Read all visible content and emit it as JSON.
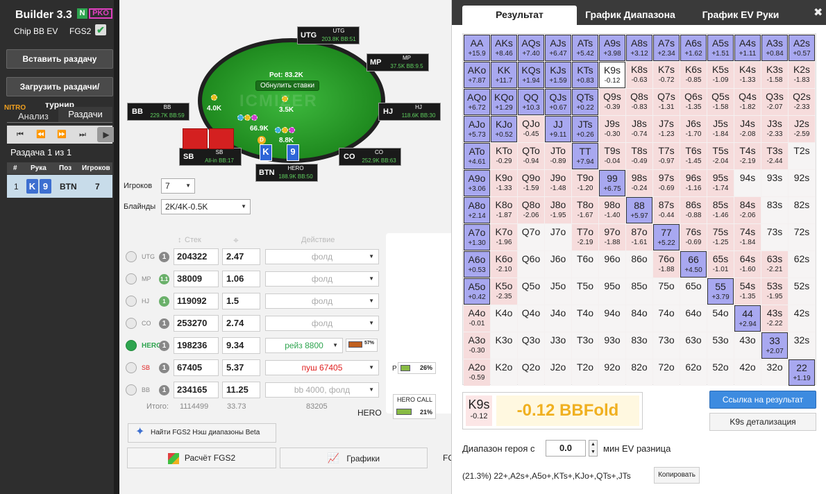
{
  "sidebar": {
    "title": "Builder 3.3",
    "badge_n": "N",
    "badge_pko": "PKO",
    "chip_label": "Chip BB EV",
    "fgs2_label": "FGS2",
    "check_glyph": "✔",
    "paste_btn": "Вставить раздачу",
    "load_btn": "Загрузить раздачи/турнир",
    "nitro": "NITRO",
    "tab_analysis": "Анализ",
    "tab_hands": "Раздачи",
    "hand_info": "Раздача 1 из 1",
    "headers": [
      "#",
      "Рука",
      "Поз",
      "Игроков"
    ],
    "row": {
      "num": "1",
      "card1": "K",
      "card2": "9",
      "pos": "BTN",
      "players": "7"
    }
  },
  "table": {
    "pot": "Pot: 83.2K",
    "reset": "Обнулить ставки",
    "logo": "ICMIZER",
    "seats": {
      "utg": {
        "name": "UTG",
        "label": "UTG",
        "stack": "203.8K BB:51"
      },
      "mp": {
        "name": "MP",
        "label": "MP",
        "stack": "37.5K BB:9.5"
      },
      "hj": {
        "name": "HJ",
        "label": "HJ",
        "stack": "118.6K BB:30"
      },
      "co": {
        "name": "CO",
        "label": "CO",
        "stack": "252.9K BB:63"
      },
      "hero": {
        "name": "BTN",
        "label": "HERO",
        "stack": "188.9K BB:50"
      },
      "sb": {
        "name": "SB",
        "label": "SB",
        "stack": "All-in BB:17"
      },
      "bb": {
        "name": "BB",
        "label": "BB",
        "stack": "229.7K BB:59"
      }
    },
    "bets": {
      "bb": "4.0K",
      "hj": "3.5K",
      "sb": "66.9K",
      "hero": "8.8K"
    },
    "hero_cards": [
      "K",
      "9"
    ],
    "dealer": "D"
  },
  "controls": {
    "players_label": "Игроков",
    "players_value": "7",
    "blinds_label": "Блайнды",
    "blinds_value": "2K/4K-0.5K",
    "col_stack": "Стек",
    "col_action": "Действие",
    "rows": [
      {
        "pos": "UTG",
        "circ": "1",
        "stack": "204322",
        "bb": "2.47",
        "action": "фолд"
      },
      {
        "pos": "MP",
        "circ": "1.1",
        "stack": "38009",
        "bb": "1.06",
        "action": "фолд"
      },
      {
        "pos": "HJ",
        "circ": "1",
        "stack": "119092",
        "bb": "1.5",
        "action": "фолд"
      },
      {
        "pos": "CO",
        "circ": "1",
        "stack": "253270",
        "bb": "2.74",
        "action": "фолд"
      },
      {
        "pos": "HERO",
        "circ": "1",
        "stack": "198236",
        "bb": "9.34",
        "action": "рейз 8800",
        "pct": "57%"
      },
      {
        "pos": "SB",
        "circ": "1",
        "stack": "67405",
        "bb": "5.37",
        "action": "пуш 67405"
      },
      {
        "pos": "BB",
        "circ": "1",
        "stack": "234165",
        "bb": "11.25",
        "action": "bb 4000, фолд"
      }
    ],
    "total_label": "Итого:",
    "total_stack": "1114499",
    "total_bb": "33.73",
    "total_chips": "83205",
    "fgs_btn": "Найти FGS2 Нэш диапазоны Beta",
    "calc_btn": "Расчёт FGS2",
    "charts_btn": "Графики",
    "p_label": "P",
    "p_pct": "26%",
    "hero_call": "HERO CALL",
    "hero_call_pct": "21%",
    "hero_label": "HERO",
    "fc_label": "FC"
  },
  "result": {
    "tabs": [
      "Результат",
      "График Диапазона",
      "График EV Руки"
    ],
    "close": "✖",
    "selected_hand": "K9s",
    "selected_ev": "-0.12",
    "big": "-0.12 BBFold",
    "link_btn": "Ссылка на результат",
    "detail_btn": "K9s детализация",
    "range_label": "Диапазон героя с",
    "min_ev": "0.0",
    "range_suffix": "мин EV разница",
    "range_str": "(21.3%) 22+,A2s+,A5o+,KTs+,KJo+,QTs+,JTs",
    "copy_btn": "Копировать",
    "grid": [
      [
        [
          "AA",
          "+15.9",
          "in"
        ],
        [
          "AKs",
          "+8.46",
          "in"
        ],
        [
          "AQs",
          "+7.40",
          "in"
        ],
        [
          "AJs",
          "+6.47",
          "in"
        ],
        [
          "ATs",
          "+5.42",
          "in"
        ],
        [
          "A9s",
          "+3.98",
          "in"
        ],
        [
          "A8s",
          "+3.12",
          "in"
        ],
        [
          "A7s",
          "+2.34",
          "in"
        ],
        [
          "A6s",
          "+1.62",
          "in"
        ],
        [
          "A5s",
          "+1.51",
          "in"
        ],
        [
          "A4s",
          "+1.11",
          "in"
        ],
        [
          "A3s",
          "+0.84",
          "in"
        ],
        [
          "A2s",
          "+0.57",
          "in"
        ]
      ],
      [
        [
          "AKo",
          "+7.87",
          "in"
        ],
        [
          "KK",
          "+11.7",
          "in"
        ],
        [
          "KQs",
          "+1.94",
          "in"
        ],
        [
          "KJs",
          "+1.59",
          "in"
        ],
        [
          "KTs",
          "+0.83",
          "in"
        ],
        [
          "K9s",
          "-0.12",
          "mid"
        ],
        [
          "K8s",
          "-0.63",
          "neg"
        ],
        [
          "K7s",
          "-0.72",
          "neg"
        ],
        [
          "K6s",
          "-0.85",
          "neg"
        ],
        [
          "K5s",
          "-1.09",
          "neg"
        ],
        [
          "K4s",
          "-1.33",
          "neg"
        ],
        [
          "K3s",
          "-1.58",
          "neg"
        ],
        [
          "K2s",
          "-1.83",
          "neg"
        ]
      ],
      [
        [
          "AQo",
          "+6.72",
          "in"
        ],
        [
          "KQo",
          "+1.29",
          "in"
        ],
        [
          "QQ",
          "+10.3",
          "in"
        ],
        [
          "QJs",
          "+0.67",
          "in"
        ],
        [
          "QTs",
          "+0.22",
          "in"
        ],
        [
          "Q9s",
          "-0.39",
          "neg"
        ],
        [
          "Q8s",
          "-0.83",
          "neg"
        ],
        [
          "Q7s",
          "-1.31",
          "neg"
        ],
        [
          "Q6s",
          "-1.35",
          "neg"
        ],
        [
          "Q5s",
          "-1.58",
          "neg"
        ],
        [
          "Q4s",
          "-1.82",
          "neg"
        ],
        [
          "Q3s",
          "-2.07",
          "neg"
        ],
        [
          "Q2s",
          "-2.33",
          "neg"
        ]
      ],
      [
        [
          "AJo",
          "+5.73",
          "in"
        ],
        [
          "KJo",
          "+0.52",
          "in"
        ],
        [
          "QJo",
          "-0.45",
          "neg"
        ],
        [
          "JJ",
          "+9.11",
          "in"
        ],
        [
          "JTs",
          "+0.26",
          "in"
        ],
        [
          "J9s",
          "-0.30",
          "neg"
        ],
        [
          "J8s",
          "-0.74",
          "neg"
        ],
        [
          "J7s",
          "-1.23",
          "neg"
        ],
        [
          "J6s",
          "-1.70",
          "neg"
        ],
        [
          "J5s",
          "-1.84",
          "neg"
        ],
        [
          "J4s",
          "-2.08",
          "neg"
        ],
        [
          "J3s",
          "-2.33",
          "neg"
        ],
        [
          "J2s",
          "-2.59",
          "neg"
        ]
      ],
      [
        [
          "ATo",
          "+4.61",
          "in"
        ],
        [
          "KTo",
          "-0.29",
          "neg"
        ],
        [
          "QTo",
          "-0.94",
          "neg"
        ],
        [
          "JTo",
          "-0.89",
          "neg"
        ],
        [
          "TT",
          "+7.94",
          "in"
        ],
        [
          "T9s",
          "-0.04",
          "neg"
        ],
        [
          "T8s",
          "-0.49",
          "neg"
        ],
        [
          "T7s",
          "-0.97",
          "neg"
        ],
        [
          "T6s",
          "-1.45",
          "neg"
        ],
        [
          "T5s",
          "-2.04",
          "neg"
        ],
        [
          "T4s",
          "-2.19",
          "neg"
        ],
        [
          "T3s",
          "-2.44",
          "neg"
        ],
        [
          "T2s",
          "",
          "out"
        ]
      ],
      [
        [
          "A9o",
          "+3.06",
          "in"
        ],
        [
          "K9o",
          "-1.33",
          "neg"
        ],
        [
          "Q9o",
          "-1.59",
          "neg"
        ],
        [
          "J9o",
          "-1.48",
          "neg"
        ],
        [
          "T9o",
          "-1.20",
          "neg"
        ],
        [
          "99",
          "+6.75",
          "in"
        ],
        [
          "98s",
          "-0.24",
          "neg"
        ],
        [
          "97s",
          "-0.69",
          "neg"
        ],
        [
          "96s",
          "-1.16",
          "neg"
        ],
        [
          "95s",
          "-1.74",
          "neg"
        ],
        [
          "94s",
          "",
          "out"
        ],
        [
          "93s",
          "",
          "out"
        ],
        [
          "92s",
          "",
          "out"
        ]
      ],
      [
        [
          "A8o",
          "+2.14",
          "in"
        ],
        [
          "K8o",
          "-1.87",
          "neg"
        ],
        [
          "Q8o",
          "-2.06",
          "neg"
        ],
        [
          "J8o",
          "-1.95",
          "neg"
        ],
        [
          "T8o",
          "-1.67",
          "neg"
        ],
        [
          "98o",
          "-1.40",
          "neg"
        ],
        [
          "88",
          "+5.97",
          "in"
        ],
        [
          "87s",
          "-0.44",
          "neg"
        ],
        [
          "86s",
          "-0.88",
          "neg"
        ],
        [
          "85s",
          "-1.46",
          "neg"
        ],
        [
          "84s",
          "-2.06",
          "neg"
        ],
        [
          "83s",
          "",
          "out"
        ],
        [
          "82s",
          "",
          "out"
        ]
      ],
      [
        [
          "A7o",
          "+1.30",
          "in"
        ],
        [
          "K7o",
          "-1.96",
          "neg"
        ],
        [
          "Q7o",
          "",
          "out"
        ],
        [
          "J7o",
          "",
          "out"
        ],
        [
          "T7o",
          "-2.19",
          "neg"
        ],
        [
          "97o",
          "-1.88",
          "neg"
        ],
        [
          "87o",
          "-1.61",
          "neg"
        ],
        [
          "77",
          "+5.22",
          "in"
        ],
        [
          "76s",
          "-0.69",
          "neg"
        ],
        [
          "75s",
          "-1.25",
          "neg"
        ],
        [
          "74s",
          "-1.84",
          "neg"
        ],
        [
          "73s",
          "",
          "out"
        ],
        [
          "72s",
          "",
          "out"
        ]
      ],
      [
        [
          "A6o",
          "+0.53",
          "in"
        ],
        [
          "K6o",
          "-2.10",
          "neg"
        ],
        [
          "Q6o",
          "",
          "out"
        ],
        [
          "J6o",
          "",
          "out"
        ],
        [
          "T6o",
          "",
          "out"
        ],
        [
          "96o",
          "",
          "out"
        ],
        [
          "86o",
          "",
          "out"
        ],
        [
          "76o",
          "-1.88",
          "neg"
        ],
        [
          "66",
          "+4.50",
          "in"
        ],
        [
          "65s",
          "-1.01",
          "neg"
        ],
        [
          "64s",
          "-1.60",
          "neg"
        ],
        [
          "63s",
          "-2.21",
          "neg"
        ],
        [
          "62s",
          "",
          "out"
        ]
      ],
      [
        [
          "A5o",
          "+0.42",
          "in"
        ],
        [
          "K5o",
          "-2.35",
          "neg"
        ],
        [
          "Q5o",
          "",
          "out"
        ],
        [
          "J5o",
          "",
          "out"
        ],
        [
          "T5o",
          "",
          "out"
        ],
        [
          "95o",
          "",
          "out"
        ],
        [
          "85o",
          "",
          "out"
        ],
        [
          "75o",
          "",
          "out"
        ],
        [
          "65o",
          "",
          "out"
        ],
        [
          "55",
          "+3.79",
          "in"
        ],
        [
          "54s",
          "-1.35",
          "neg"
        ],
        [
          "53s",
          "-1.95",
          "neg"
        ],
        [
          "52s",
          "",
          "out"
        ]
      ],
      [
        [
          "A4o",
          "-0.01",
          "neg"
        ],
        [
          "K4o",
          "",
          "out"
        ],
        [
          "Q4o",
          "",
          "out"
        ],
        [
          "J4o",
          "",
          "out"
        ],
        [
          "T4o",
          "",
          "out"
        ],
        [
          "94o",
          "",
          "out"
        ],
        [
          "84o",
          "",
          "out"
        ],
        [
          "74o",
          "",
          "out"
        ],
        [
          "64o",
          "",
          "out"
        ],
        [
          "54o",
          "",
          "out"
        ],
        [
          "44",
          "+2.94",
          "in"
        ],
        [
          "43s",
          "-2.22",
          "neg"
        ],
        [
          "42s",
          "",
          "out"
        ]
      ],
      [
        [
          "A3o",
          "-0.30",
          "neg"
        ],
        [
          "K3o",
          "",
          "out"
        ],
        [
          "Q3o",
          "",
          "out"
        ],
        [
          "J3o",
          "",
          "out"
        ],
        [
          "T3o",
          "",
          "out"
        ],
        [
          "93o",
          "",
          "out"
        ],
        [
          "83o",
          "",
          "out"
        ],
        [
          "73o",
          "",
          "out"
        ],
        [
          "63o",
          "",
          "out"
        ],
        [
          "53o",
          "",
          "out"
        ],
        [
          "43o",
          "",
          "out"
        ],
        [
          "33",
          "+2.07",
          "in"
        ],
        [
          "32s",
          "",
          "out"
        ]
      ],
      [
        [
          "A2o",
          "-0.59",
          "neg"
        ],
        [
          "K2o",
          "",
          "out"
        ],
        [
          "Q2o",
          "",
          "out"
        ],
        [
          "J2o",
          "",
          "out"
        ],
        [
          "T2o",
          "",
          "out"
        ],
        [
          "92o",
          "",
          "out"
        ],
        [
          "82o",
          "",
          "out"
        ],
        [
          "72o",
          "",
          "out"
        ],
        [
          "62o",
          "",
          "out"
        ],
        [
          "52o",
          "",
          "out"
        ],
        [
          "42o",
          "",
          "out"
        ],
        [
          "32o",
          "",
          "out"
        ],
        [
          "22",
          "+1.19",
          "in"
        ]
      ]
    ]
  }
}
